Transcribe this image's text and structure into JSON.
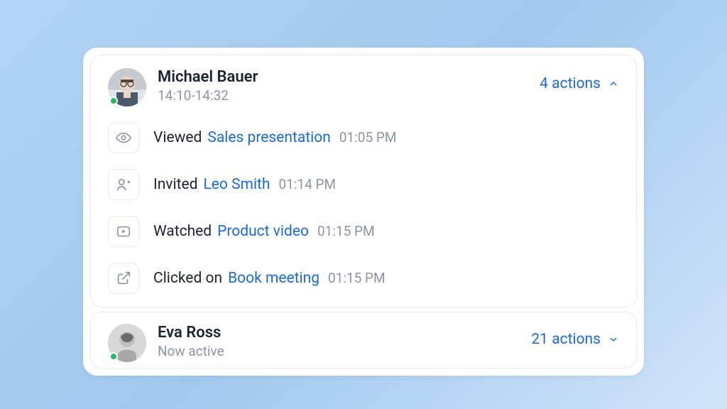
{
  "users": [
    {
      "name": "Michael Bauer",
      "sub": "14:10-14:32",
      "actions_label": "4 actions",
      "expanded": true,
      "activities": [
        {
          "verb": "Viewed",
          "link": "Sales presentation",
          "time": "01:05 PM",
          "icon": "eye"
        },
        {
          "verb": "Invited",
          "link": "Leo Smith",
          "time": "01:14 PM",
          "icon": "user-plus"
        },
        {
          "verb": "Watched",
          "link": "Product video",
          "time": "01:15 PM",
          "icon": "play"
        },
        {
          "verb": "Clicked on",
          "link": "Book meeting",
          "time": "01:15 PM",
          "icon": "external"
        }
      ]
    },
    {
      "name": "Eva Ross",
      "sub": "Now active",
      "actions_label": "21 actions",
      "expanded": false
    }
  ]
}
